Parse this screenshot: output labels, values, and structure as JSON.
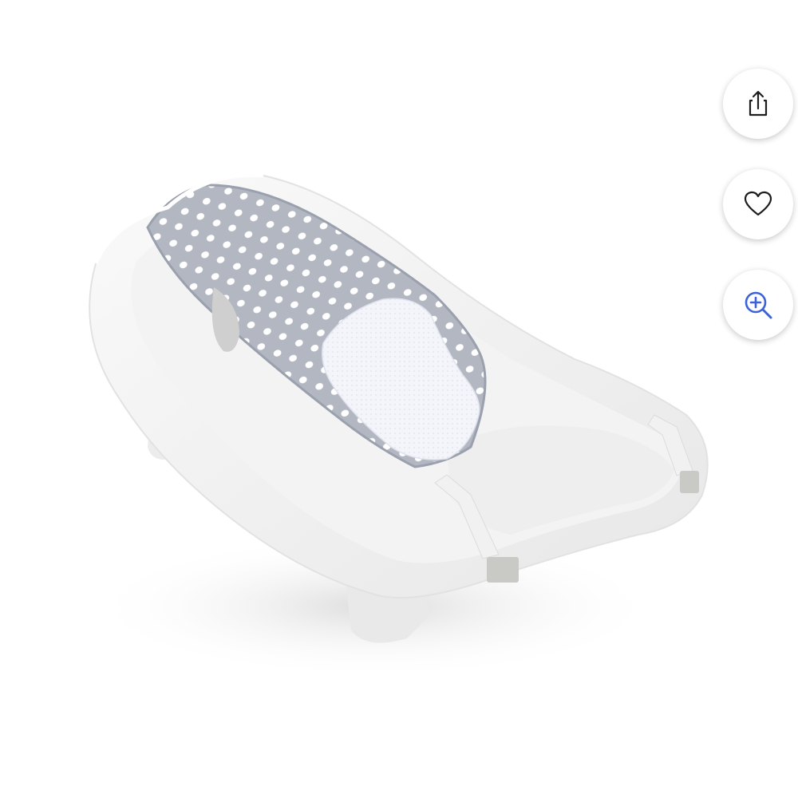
{
  "product": {
    "image_alt": "White infant bath tub with gray polka-dot mesh sling"
  },
  "actions": {
    "share": {
      "icon": "share-icon",
      "label": "Share"
    },
    "favorite": {
      "icon": "heart-icon",
      "label": "Favorite"
    },
    "zoom": {
      "icon": "zoom-in-icon",
      "label": "Zoom",
      "color": "#3b62d6"
    }
  },
  "colors": {
    "background": "#ffffff",
    "button_bg": "#ffffff",
    "icon_dark": "#1d1d1f",
    "accent": "#3b62d6"
  }
}
